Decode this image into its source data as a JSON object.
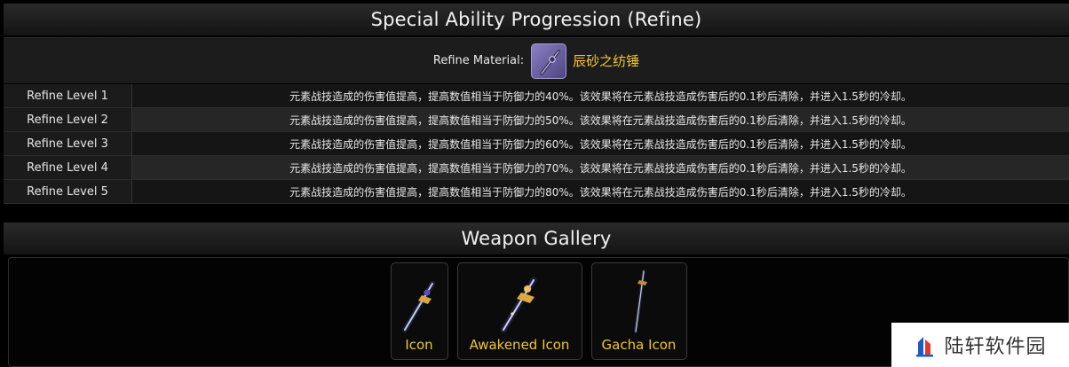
{
  "refine_section": {
    "title": "Special Ability Progression (Refine)",
    "material_label": "Refine Material:",
    "material_icon": "spindle-item-icon",
    "material_name": "辰砂之纺锤",
    "levels": [
      {
        "label": "Refine Level 1",
        "description": "元素战技造成的伤害值提高，提高数值相当于防御力的40%。该效果将在元素战技造成伤害后的0.1秒后清除，并进入1.5秒的冷却。"
      },
      {
        "label": "Refine Level 2",
        "description": "元素战技造成的伤害值提高，提高数值相当于防御力的50%。该效果将在元素战技造成伤害后的0.1秒后清除，并进入1.5秒的冷却。"
      },
      {
        "label": "Refine Level 3",
        "description": "元素战技造成的伤害值提高，提高数值相当于防御力的60%。该效果将在元素战技造成伤害后的0.1秒后清除，并进入1.5秒的冷却。"
      },
      {
        "label": "Refine Level 4",
        "description": "元素战技造成的伤害值提高，提高数值相当于防御力的70%。该效果将在元素战技造成伤害后的0.1秒后清除，并进入1.5秒的冷却。"
      },
      {
        "label": "Refine Level 5",
        "description": "元素战技造成的伤害值提高，提高数值相当于防御力的80%。该效果将在元素战技造成伤害后的0.1秒后清除，并进入1.5秒的冷却。"
      }
    ]
  },
  "gallery_section": {
    "title": "Weapon Gallery",
    "items": [
      {
        "caption": "Icon",
        "icon": "sword-icon"
      },
      {
        "caption": "Awakened Icon",
        "icon": "awakened-sword-icon"
      },
      {
        "caption": "Gacha Icon",
        "icon": "gacha-sword-icon"
      }
    ]
  },
  "watermark": {
    "text": "陆轩软件园",
    "icon": "lx-logo-icon"
  },
  "colors": {
    "accent": "#f3c534",
    "background": "#000000",
    "header_gradient_top": "#2a2a2a",
    "header_gradient_bottom": "#141414"
  }
}
